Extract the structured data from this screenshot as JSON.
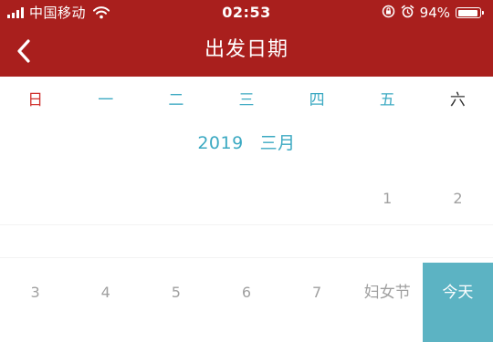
{
  "status_bar": {
    "carrier": "中国移动",
    "time": "02:53",
    "battery_percent": "94%",
    "battery_level": 0.94,
    "icons": [
      "signal-icon",
      "wifi-icon",
      "lock-rotation-icon",
      "alarm-icon",
      "battery-icon"
    ]
  },
  "nav": {
    "title": "出发日期",
    "back_icon": "chevron-left-icon"
  },
  "weekdays": [
    "日",
    "一",
    "二",
    "三",
    "四",
    "五",
    "六"
  ],
  "month": {
    "year": "2019",
    "name": "三月"
  },
  "weeks": [
    [
      "",
      "",
      "",
      "",
      "",
      "1",
      "2"
    ],
    [
      "3",
      "4",
      "5",
      "6",
      "7",
      "妇女节",
      "今天"
    ]
  ],
  "colors": {
    "header": "#a91f1d",
    "accent": "#3ba9c2",
    "sunday": "#d0312d",
    "today_bg": "#5cb3c3",
    "day_text": "#a0a0a0"
  }
}
